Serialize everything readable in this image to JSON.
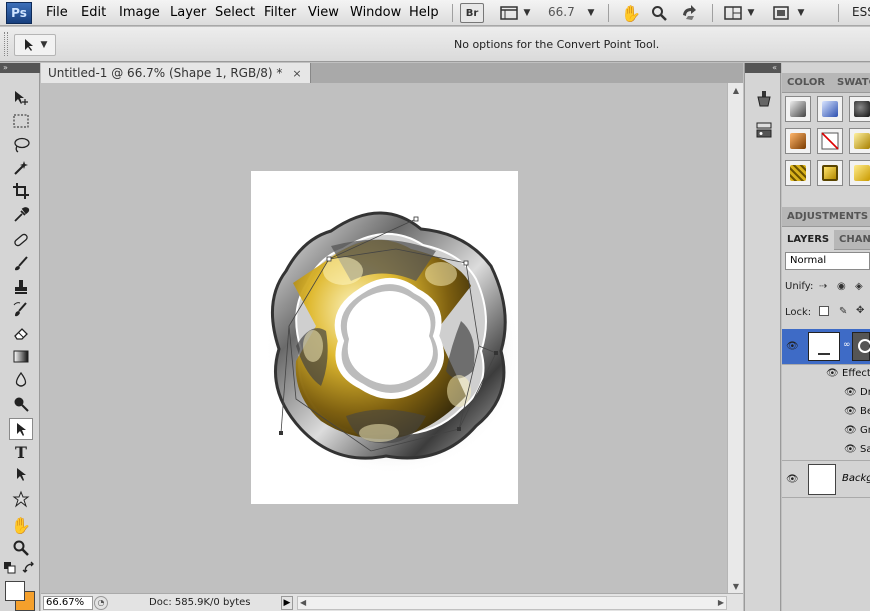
{
  "app": {
    "logo": "Ps",
    "menus": [
      "File",
      "Edit",
      "Image",
      "Layer",
      "Select",
      "Filter",
      "View",
      "Window",
      "Help"
    ],
    "bridge_label": "Br",
    "zoom_level": "66.7",
    "workspace_label": "ESS"
  },
  "options_bar": {
    "message": "No options for the Convert Point Tool."
  },
  "document": {
    "tab_title": "Untitled-1 @ 66.7% (Shape 1, RGB/8) *",
    "close_glyph": "×",
    "status_zoom": "66.67%",
    "status_doc": "Doc: 585.9K/0 bytes"
  },
  "colors": {
    "foreground": "#ffffff",
    "background": "#f5a02c",
    "layer_selected": "#3e6bc6",
    "gold": "#c9a21a"
  },
  "panels": {
    "color_tab": "COLOR",
    "swatches_tab": "SWATC",
    "adjustments_tab": "ADJUSTMENTS",
    "layers_tab": "LAYERS",
    "channels_tab": "CHAN",
    "blend_mode": "Normal",
    "unify_label": "Unify:",
    "lock_label": "Lock:",
    "effects_label": "Effects",
    "effects": [
      "Dr",
      "Be",
      "Gr",
      "Sa"
    ],
    "background_layer": "Backg"
  }
}
